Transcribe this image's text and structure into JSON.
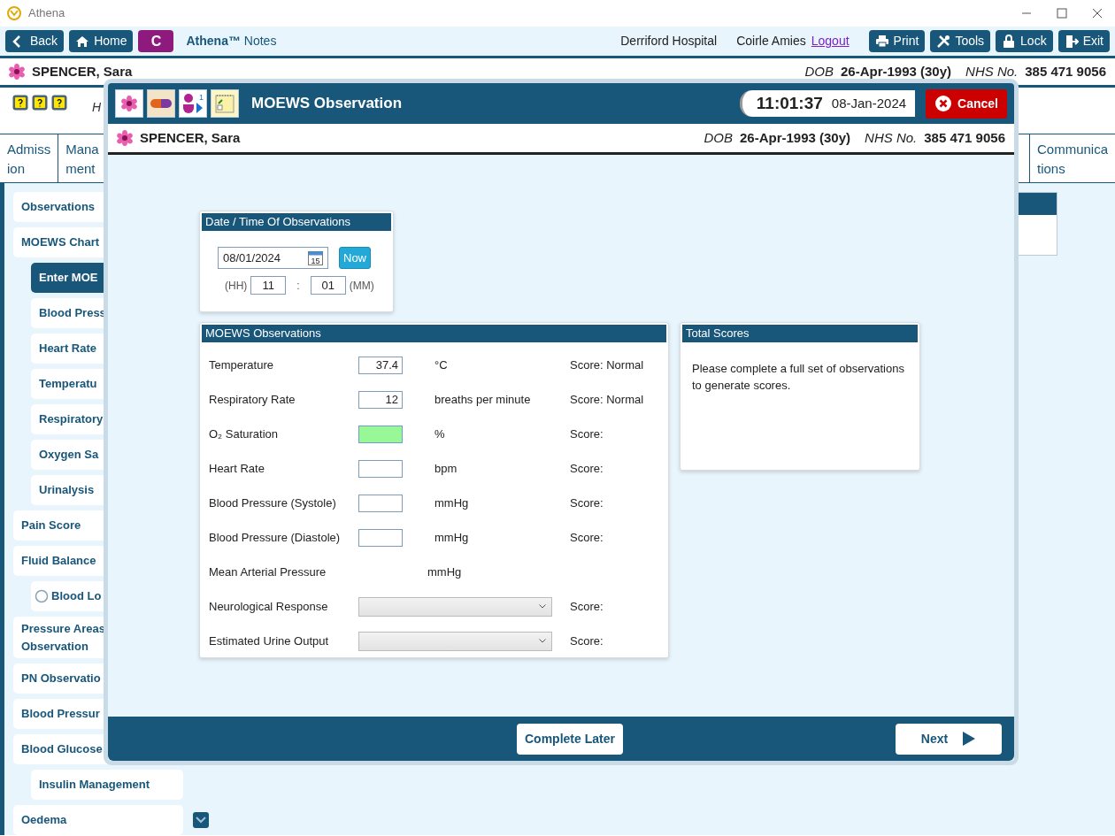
{
  "window": {
    "title": "Athena"
  },
  "toolbar": {
    "buttons_left": [
      {
        "label": "Back"
      },
      {
        "label": "Home"
      }
    ],
    "context_badge": "C",
    "app_name": "Athena™",
    "app_suffix": "Notes",
    "hospital": "Derriford Hospital",
    "user": "Coirle Amies",
    "logout": "Logout",
    "buttons_right": [
      {
        "label": "Print"
      },
      {
        "label": "Tools"
      },
      {
        "label": "Lock"
      },
      {
        "label": "Exit"
      }
    ]
  },
  "patient": {
    "name": "SPENCER, Sara",
    "dob_label": "DOB",
    "dob": "26-Apr-1993 (30y)",
    "nhs_label": "NHS No.",
    "nhs": "385 471 9056"
  },
  "help_row": {
    "text": "H"
  },
  "tabs": [
    {
      "lines": [
        "Admiss",
        "ion"
      ]
    },
    {
      "lines": [
        "Mana",
        "ment"
      ]
    },
    {
      "lines": [
        "Communica",
        "tions"
      ]
    }
  ],
  "sidebar": {
    "items": [
      {
        "label": "Observations",
        "kind": "link",
        "selected": false
      },
      {
        "label": "MOEWS Chart",
        "kind": "link",
        "selected": false,
        "children": [
          {
            "label": "Enter MOE",
            "kind": "link",
            "selected": true
          },
          {
            "label": "Blood Press",
            "kind": "link",
            "selected": false
          },
          {
            "label": "Heart Rate",
            "kind": "link",
            "selected": false
          },
          {
            "label": "Temperatu",
            "kind": "link",
            "selected": false
          },
          {
            "label": "Respiratory",
            "kind": "link",
            "selected": false
          },
          {
            "label": "Oxygen Sa",
            "kind": "link",
            "selected": false
          },
          {
            "label": "Urinalysis",
            "kind": "link",
            "selected": false
          }
        ]
      },
      {
        "label": "Pain Score",
        "kind": "link",
        "selected": false
      },
      {
        "label": "Fluid Balance",
        "kind": "link",
        "selected": false,
        "children": [
          {
            "label": "Blood Lo",
            "kind": "radio",
            "checked": false,
            "selected": false
          }
        ]
      },
      {
        "label": "Pressure Areas Observation",
        "kind": "link",
        "selected": false
      },
      {
        "label": "PN Observatio",
        "kind": "link",
        "selected": false
      },
      {
        "label": "Blood Pressur",
        "kind": "link",
        "selected": false
      },
      {
        "label": "Blood Glucose",
        "kind": "link",
        "selected": false,
        "children": [
          {
            "label": "Insulin Management",
            "kind": "link",
            "selected": false
          }
        ]
      },
      {
        "label": "Oedema",
        "kind": "link",
        "selected": false
      }
    ]
  },
  "modal": {
    "title": "MOEWS Observation",
    "person_badge": "1",
    "clock": "11:01:37",
    "date": "08-Jan-2024",
    "cancel": "Cancel",
    "patient": {
      "name": "SPENCER, Sara",
      "dob_label": "DOB",
      "dob": "26-Apr-1993 (30y)",
      "nhs_label": "NHS No.",
      "nhs": "385 471 9056"
    },
    "datetime_panel": {
      "title": "Date / Time Of Observations",
      "date": "08/01/2024",
      "calendar_day": "15",
      "now": "Now",
      "hh_label": "(HH)",
      "hh": "11",
      "separator": ":",
      "mm": "01",
      "mm_label": "(MM)"
    },
    "observations_panel": {
      "title": "MOEWS Observations",
      "rows": [
        {
          "kind": "input",
          "label": "Temperature",
          "value": "37.4",
          "focused": false,
          "unit": "°C",
          "score": "Score: Normal"
        },
        {
          "kind": "input",
          "label": "Respiratory Rate",
          "value": "12",
          "focused": false,
          "unit": "breaths per minute",
          "score": "Score: Normal"
        },
        {
          "kind": "input",
          "label": "O₂ Saturation",
          "focused": true,
          "unit": "%",
          "score": "Score:"
        },
        {
          "kind": "input",
          "label": "Heart Rate",
          "focused": false,
          "unit": "bpm",
          "score": "Score:"
        },
        {
          "kind": "input",
          "label": "Blood Pressure (Systole)",
          "focused": false,
          "unit": "mmHg",
          "score": "Score:"
        },
        {
          "kind": "input",
          "label": "Blood Pressure (Diastole)",
          "focused": false,
          "unit": "mmHg",
          "score": "Score:"
        },
        {
          "kind": "text",
          "label": "Mean Arterial Pressure",
          "unit": "mmHg"
        },
        {
          "kind": "select",
          "label": "Neurological Response",
          "score": "Score:"
        },
        {
          "kind": "select",
          "label": "Estimated Urine Output",
          "score": "Score:"
        }
      ]
    },
    "totals_panel": {
      "title": "Total Scores",
      "message": "Please complete a full set of observations to generate scores."
    },
    "footer": {
      "complete_later": "Complete Later",
      "next": "Next"
    }
  }
}
